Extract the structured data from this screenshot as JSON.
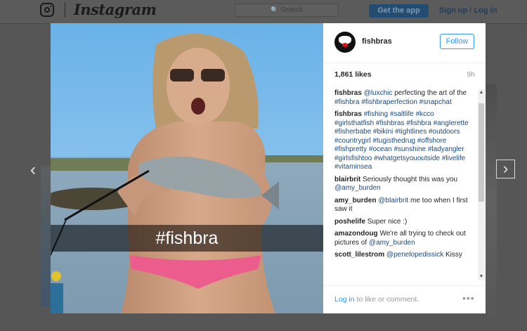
{
  "nav": {
    "brand": "Instagram",
    "search_placeholder": "Search",
    "search_icon": "🔍",
    "get_app_label": "Get the app",
    "signup_label": "Sign up",
    "login_label": "Log in",
    "separator": "/",
    "icon": "instagram-camera-icon"
  },
  "arrows": {
    "prev": "‹",
    "next": "›"
  },
  "post": {
    "image_caption": "#fishbra",
    "username": "fishbras",
    "follow_label": "Follow",
    "likes": "1,861 likes",
    "time": "9h",
    "comments": [
      {
        "user": "fishbras",
        "text": "perfecting the art of the",
        "mention": "@luxchic",
        "tags": "#fishbra #fishbraperfection #snapchat"
      },
      {
        "user": "fishbras",
        "tags": "#fishing #saltlife #kcco #girlsthatfish #fishbras #fishbra #anglerette #fisherbabe #bikini #tightlines #outdoors #countrygirl #tugisthedrug #offshore #fishpretty #ocean #sunshine #ladyangler #girlsfishtoo #whatgetsyououtside #livelife #vitaminsea"
      },
      {
        "user": "blairbrit",
        "text": "Seriously thought this was you",
        "mention": "@amy_burden"
      },
      {
        "user": "amy_burden",
        "mention": "@blairbrit",
        "text": "me too when I first saw it"
      },
      {
        "user": "poshelife",
        "text": "Super nice :)"
      },
      {
        "user": "amazondoug",
        "text": "We're all trying to check out pictures of",
        "mention": "@amy_burden"
      },
      {
        "user": "scott_lilestrom",
        "mention": "@penelopedissick",
        "text": "Kissy"
      }
    ],
    "login_link": "Log in",
    "login_rest": "to like or comment.",
    "more": "•••"
  },
  "colors": {
    "accent": "#3897f0",
    "link": "#1a4a7e",
    "overlay": "#565656"
  }
}
